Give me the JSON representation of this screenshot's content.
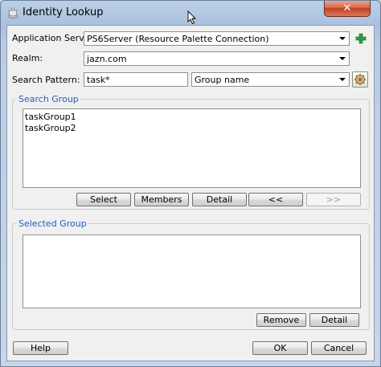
{
  "window": {
    "title": "Identity Lookup",
    "close_label": "✕"
  },
  "form": {
    "app_server_label": "Application Server:",
    "app_server_value": "PS6Server (Resource Palette Connection)",
    "realm_label": "Realm:",
    "realm_value": "jazn.com",
    "search_pattern_label": "Search Pattern:",
    "search_pattern_value": "task*",
    "search_type_value": "Group name"
  },
  "search_group": {
    "title": "Search Group",
    "items": [
      "taskGroup1",
      "taskGroup2"
    ],
    "buttons": {
      "select": "Select",
      "members": "Members",
      "detail": "Detail",
      "move_left": "<<",
      "move_right": ">>"
    }
  },
  "selected_group": {
    "title": "Selected Group",
    "buttons": {
      "remove": "Remove",
      "detail": "Detail"
    }
  },
  "footer": {
    "help": "Help",
    "ok": "OK",
    "cancel": "Cancel"
  },
  "icons": {
    "add": "plus-icon",
    "lookup": "gear-icon",
    "app": "coffee-cup-icon"
  },
  "colors": {
    "group_title": "#1f5ebf",
    "add_icon": "#2ea043",
    "close_button": "#c2401f"
  }
}
